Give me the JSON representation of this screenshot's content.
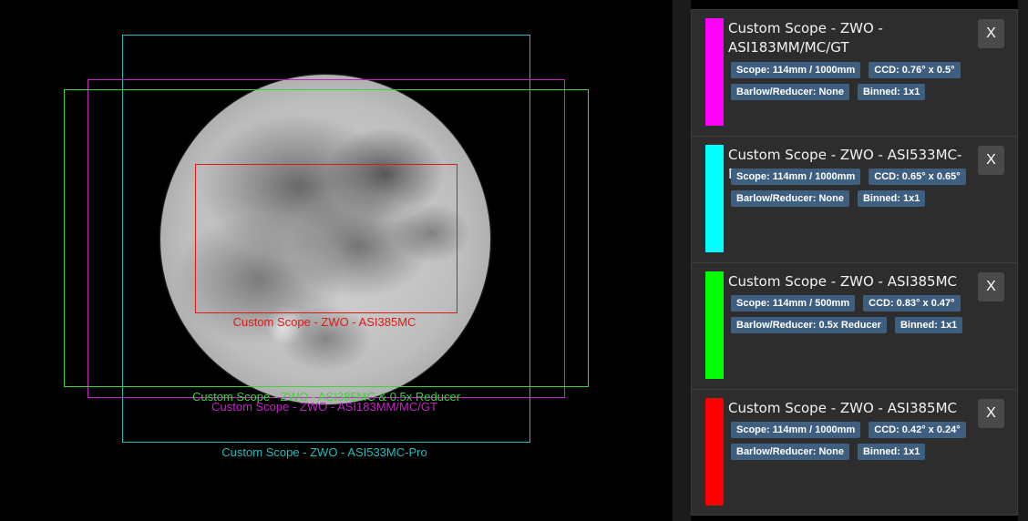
{
  "overlay_labels": {
    "asi385mc": "Custom Scope - ZWO - ASI385MC",
    "asi385mc_reducer": "Custom Scope - ZWO - ASI385MC & 0.5x Reducer",
    "asi183": "Custom Scope - ZWO - ASI183MM/MC/GT",
    "asi533": "Custom Scope - ZWO - ASI533MC-Pro"
  },
  "colors": {
    "magenta": "#ff00ff",
    "cyan": "#00ffff",
    "green": "#00ff00",
    "red": "#ff0000",
    "overlay_red": "#e01818",
    "overlay_green": "#3cd33c",
    "overlay_magenta": "#c822c8",
    "overlay_cyan": "#22bcbc"
  },
  "cards": [
    {
      "title": "Custom Scope - ZWO - ASI183MM/MC/GT",
      "color": "#ff00ff",
      "scope": "Scope: 114mm / 1000mm",
      "ccd": "CCD: 0.76° x 0.5°",
      "barlow": "Barlow/Reducer: None",
      "binned": "Binned: 1x1",
      "close": "X"
    },
    {
      "title": "Custom Scope - ZWO - ASI533MC-Pro",
      "color": "#00ffff",
      "scope": "Scope: 114mm / 1000mm",
      "ccd": "CCD: 0.65° x 0.65°",
      "barlow": "Barlow/Reducer: None",
      "binned": "Binned: 1x1",
      "close": "X"
    },
    {
      "title": "Custom Scope - ZWO - ASI385MC",
      "color": "#00ff00",
      "scope": "Scope: 114mm / 500mm",
      "ccd": "CCD: 0.83° x 0.47°",
      "barlow": "Barlow/Reducer: 0.5x Reducer",
      "binned": "Binned: 1x1",
      "close": "X"
    },
    {
      "title": "Custom Scope - ZWO - ASI385MC",
      "color": "#ff0000",
      "scope": "Scope: 114mm / 1000mm",
      "ccd": "CCD: 0.42° x 0.24°",
      "barlow": "Barlow/Reducer: None",
      "binned": "Binned: 1x1",
      "close": "X"
    }
  ]
}
